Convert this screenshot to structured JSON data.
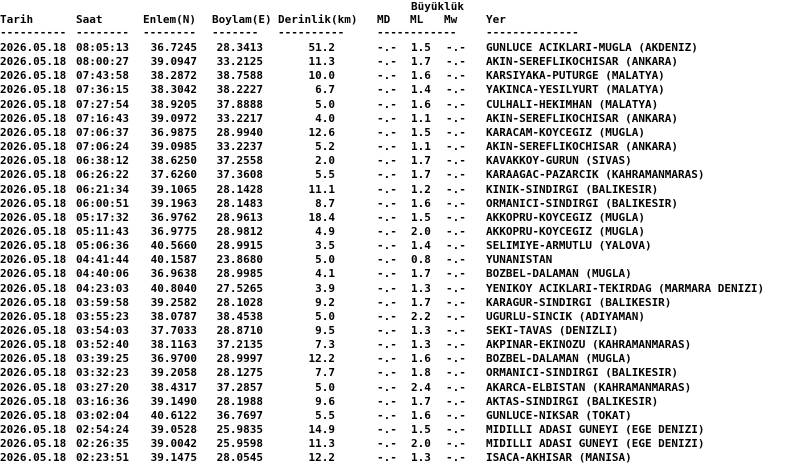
{
  "header": {
    "group_title": "Büyüklük",
    "columns": {
      "date": "Tarih",
      "time": "Saat",
      "lat": "Enlem(N)",
      "lon": "Boylam(E)",
      "depth": "Derinlik(km)",
      "md": "MD",
      "ml": "ML",
      "mw": "Mw",
      "place": "Yer"
    },
    "separators": {
      "date": "----------",
      "time": "--------",
      "lat": "--------",
      "lon": "-------",
      "depth": "----------",
      "md": "------------",
      "place": "--------------"
    }
  },
  "rows": [
    {
      "date": "2026.05.18",
      "time": "08:05:13",
      "lat": "36.7245",
      "lon": "28.3413",
      "depth": "51.2",
      "md": "-.-",
      "ml": "1.5",
      "mw": "-.-",
      "place": "GUNLUCE ACIKLARI-MUGLA (AKDENIZ)"
    },
    {
      "date": "2026.05.18",
      "time": "08:00:27",
      "lat": "39.0947",
      "lon": "33.2125",
      "depth": "11.3",
      "md": "-.-",
      "ml": "1.7",
      "mw": "-.-",
      "place": "AKIN-SEREFLIKOCHISAR (ANKARA)"
    },
    {
      "date": "2026.05.18",
      "time": "07:43:58",
      "lat": "38.2872",
      "lon": "38.7588",
      "depth": "10.0",
      "md": "-.-",
      "ml": "1.6",
      "mw": "-.-",
      "place": "KARSIYAKA-PUTURGE (MALATYA)"
    },
    {
      "date": "2026.05.18",
      "time": "07:36:15",
      "lat": "38.3042",
      "lon": "38.2227",
      "depth": "6.7",
      "md": "-.-",
      "ml": "1.4",
      "mw": "-.-",
      "place": "YAKINCA-YESILYURT (MALATYA)"
    },
    {
      "date": "2026.05.18",
      "time": "07:27:54",
      "lat": "38.9205",
      "lon": "37.8888",
      "depth": "5.0",
      "md": "-.-",
      "ml": "1.6",
      "mw": "-.-",
      "place": "CULHALI-HEKIMHAN (MALATYA)"
    },
    {
      "date": "2026.05.18",
      "time": "07:16:43",
      "lat": "39.0972",
      "lon": "33.2217",
      "depth": "4.0",
      "md": "-.-",
      "ml": "1.1",
      "mw": "-.-",
      "place": "AKIN-SEREFLIKOCHISAR (ANKARA)"
    },
    {
      "date": "2026.05.18",
      "time": "07:06:37",
      "lat": "36.9875",
      "lon": "28.9940",
      "depth": "12.6",
      "md": "-.-",
      "ml": "1.5",
      "mw": "-.-",
      "place": "KARACAM-KOYCEGIZ (MUGLA)"
    },
    {
      "date": "2026.05.18",
      "time": "07:06:24",
      "lat": "39.0985",
      "lon": "33.2237",
      "depth": "5.2",
      "md": "-.-",
      "ml": "1.1",
      "mw": "-.-",
      "place": "AKIN-SEREFLIKOCHISAR (ANKARA)"
    },
    {
      "date": "2026.05.18",
      "time": "06:38:12",
      "lat": "38.6250",
      "lon": "37.2558",
      "depth": "2.0",
      "md": "-.-",
      "ml": "1.7",
      "mw": "-.-",
      "place": "KAVAKKOY-GURUN (SIVAS)"
    },
    {
      "date": "2026.05.18",
      "time": "06:26:22",
      "lat": "37.6260",
      "lon": "37.3608",
      "depth": "5.5",
      "md": "-.-",
      "ml": "1.7",
      "mw": "-.-",
      "place": "KARAAGAC-PAZARCIK (KAHRAMANMARAS)"
    },
    {
      "date": "2026.05.18",
      "time": "06:21:34",
      "lat": "39.1065",
      "lon": "28.1428",
      "depth": "11.1",
      "md": "-.-",
      "ml": "1.2",
      "mw": "-.-",
      "place": "KINIK-SINDIRGI (BALIKESIR)"
    },
    {
      "date": "2026.05.18",
      "time": "06:00:51",
      "lat": "39.1963",
      "lon": "28.1483",
      "depth": "8.7",
      "md": "-.-",
      "ml": "1.6",
      "mw": "-.-",
      "place": "ORMANICI-SINDIRGI (BALIKESIR)"
    },
    {
      "date": "2026.05.18",
      "time": "05:17:32",
      "lat": "36.9762",
      "lon": "28.9613",
      "depth": "18.4",
      "md": "-.-",
      "ml": "1.5",
      "mw": "-.-",
      "place": "AKKOPRU-KOYCEGIZ (MUGLA)"
    },
    {
      "date": "2026.05.18",
      "time": "05:11:43",
      "lat": "36.9775",
      "lon": "28.9812",
      "depth": "4.9",
      "md": "-.-",
      "ml": "2.0",
      "mw": "-.-",
      "place": "AKKOPRU-KOYCEGIZ (MUGLA)"
    },
    {
      "date": "2026.05.18",
      "time": "05:06:36",
      "lat": "40.5660",
      "lon": "28.9915",
      "depth": "3.5",
      "md": "-.-",
      "ml": "1.4",
      "mw": "-.-",
      "place": "SELIMIYE-ARMUTLU (YALOVA)"
    },
    {
      "date": "2026.05.18",
      "time": "04:41:44",
      "lat": "40.1587",
      "lon": "23.8680",
      "depth": "5.0",
      "md": "-.-",
      "ml": "0.8",
      "mw": "-.-",
      "place": "YUNANISTAN"
    },
    {
      "date": "2026.05.18",
      "time": "04:40:06",
      "lat": "36.9638",
      "lon": "28.9985",
      "depth": "4.1",
      "md": "-.-",
      "ml": "1.7",
      "mw": "-.-",
      "place": "BOZBEL-DALAMAN (MUGLA)"
    },
    {
      "date": "2026.05.18",
      "time": "04:23:03",
      "lat": "40.8040",
      "lon": "27.5265",
      "depth": "3.9",
      "md": "-.-",
      "ml": "1.3",
      "mw": "-.-",
      "place": "YENIKOY ACIKLARI-TEKIRDAG (MARMARA DENIZI)"
    },
    {
      "date": "2026.05.18",
      "time": "03:59:58",
      "lat": "39.2582",
      "lon": "28.1028",
      "depth": "9.2",
      "md": "-.-",
      "ml": "1.7",
      "mw": "-.-",
      "place": "KARAGUR-SINDIRGI (BALIKESIR)"
    },
    {
      "date": "2026.05.18",
      "time": "03:55:23",
      "lat": "38.0787",
      "lon": "38.4538",
      "depth": "5.0",
      "md": "-.-",
      "ml": "2.2",
      "mw": "-.-",
      "place": "UGURLU-SINCIK (ADIYAMAN)"
    },
    {
      "date": "2026.05.18",
      "time": "03:54:03",
      "lat": "37.7033",
      "lon": "28.8710",
      "depth": "9.5",
      "md": "-.-",
      "ml": "1.3",
      "mw": "-.-",
      "place": "SEKI-TAVAS (DENIZLI)"
    },
    {
      "date": "2026.05.18",
      "time": "03:52:40",
      "lat": "38.1163",
      "lon": "37.2135",
      "depth": "7.3",
      "md": "-.-",
      "ml": "1.3",
      "mw": "-.-",
      "place": "AKPINAR-EKINOZU (KAHRAMANMARAS)"
    },
    {
      "date": "2026.05.18",
      "time": "03:39:25",
      "lat": "36.9700",
      "lon": "28.9997",
      "depth": "12.2",
      "md": "-.-",
      "ml": "1.6",
      "mw": "-.-",
      "place": "BOZBEL-DALAMAN (MUGLA)"
    },
    {
      "date": "2026.05.18",
      "time": "03:32:23",
      "lat": "39.2058",
      "lon": "28.1275",
      "depth": "7.7",
      "md": "-.-",
      "ml": "1.8",
      "mw": "-.-",
      "place": "ORMANICI-SINDIRGI (BALIKESIR)"
    },
    {
      "date": "2026.05.18",
      "time": "03:27:20",
      "lat": "38.4317",
      "lon": "37.2857",
      "depth": "5.0",
      "md": "-.-",
      "ml": "2.4",
      "mw": "-.-",
      "place": "AKARCA-ELBISTAN (KAHRAMANMARAS)"
    },
    {
      "date": "2026.05.18",
      "time": "03:16:36",
      "lat": "39.1490",
      "lon": "28.1988",
      "depth": "9.6",
      "md": "-.-",
      "ml": "1.7",
      "mw": "-.-",
      "place": "AKTAS-SINDIRGI (BALIKESIR)"
    },
    {
      "date": "2026.05.18",
      "time": "03:02:04",
      "lat": "40.6122",
      "lon": "36.7697",
      "depth": "5.5",
      "md": "-.-",
      "ml": "1.6",
      "mw": "-.-",
      "place": "GUNLUCE-NIKSAR (TOKAT)"
    },
    {
      "date": "2026.05.18",
      "time": "02:54:24",
      "lat": "39.0528",
      "lon": "25.9835",
      "depth": "14.9",
      "md": "-.-",
      "ml": "1.5",
      "mw": "-.-",
      "place": "MIDILLI ADASI GUNEYI (EGE DENIZI)"
    },
    {
      "date": "2026.05.18",
      "time": "02:26:35",
      "lat": "39.0042",
      "lon": "25.9598",
      "depth": "11.3",
      "md": "-.-",
      "ml": "2.0",
      "mw": "-.-",
      "place": "MIDILLI ADASI GUNEYI (EGE DENIZI)"
    },
    {
      "date": "2026.05.18",
      "time": "02:23:51",
      "lat": "39.1475",
      "lon": "28.0545",
      "depth": "12.2",
      "md": "-.-",
      "ml": "1.3",
      "mw": "-.-",
      "place": "ISACA-AKHISAR (MANISA)"
    }
  ]
}
